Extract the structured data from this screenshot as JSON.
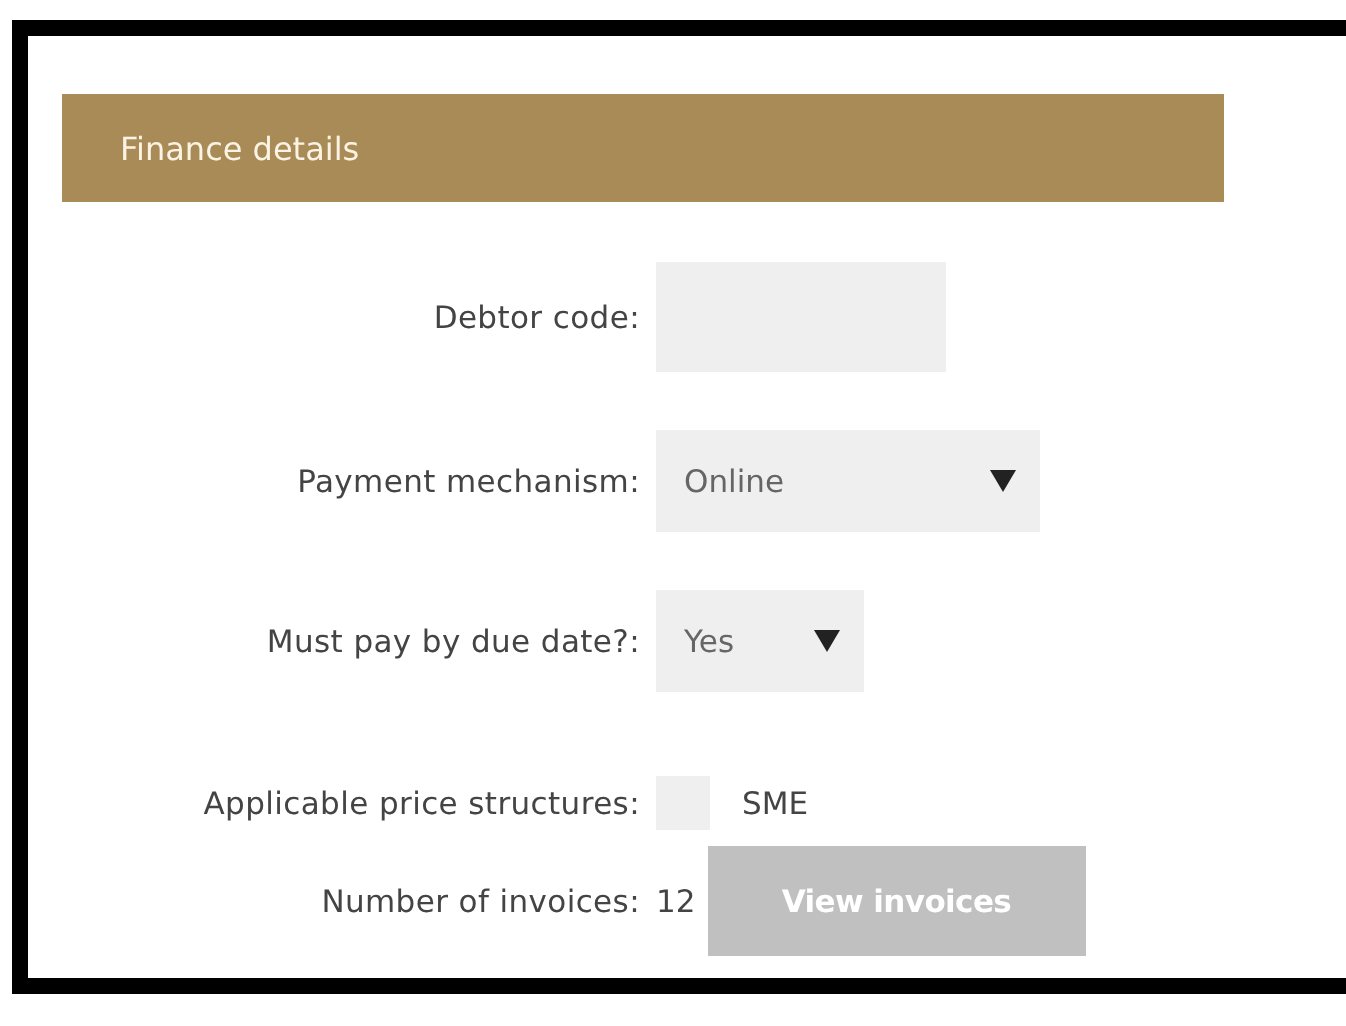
{
  "header": {
    "title": "Finance details"
  },
  "fields": [
    {
      "kind": "text",
      "label": "Debtor code:"
    },
    {
      "kind": "select",
      "label": "Payment mechanism:",
      "value": "Online"
    },
    {
      "kind": "select",
      "label": "Must pay by due date?:",
      "value": "Yes"
    },
    {
      "kind": "checkbox",
      "label": "Applicable price structures:",
      "checked": false,
      "option": "SME"
    },
    {
      "kind": "count",
      "label": "Number of invoices:",
      "value": "12",
      "button": {
        "label": "View invoices",
        "disabled": true
      }
    }
  ]
}
